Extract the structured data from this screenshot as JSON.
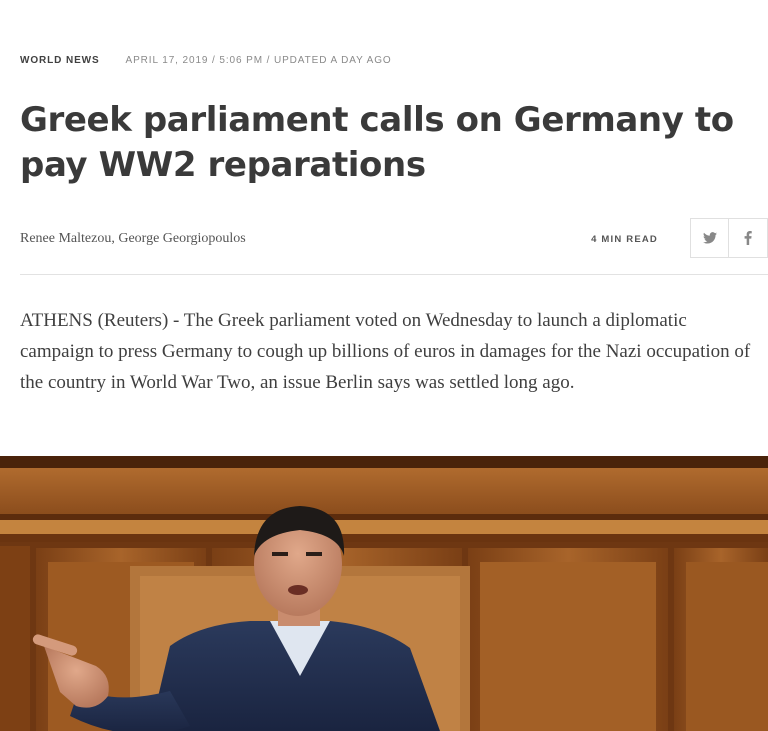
{
  "article": {
    "channel": "World News",
    "timestamp": "April 17, 2019 / 5:06 PM / Updated a day ago",
    "headline": "Greek parliament calls on Germany to pay WW2 reparations",
    "authors": "Renee Maltezou, George Georgiopoulos",
    "read_time": "4 Min Read",
    "lede": "ATHENS (Reuters) - The Greek parliament voted on Wednesday to launch a diplomatic campaign to press Germany to cough up billions of euros in damages for the Nazi occupation of the country in World War Two, an issue Berlin says was settled long ago."
  },
  "share": {
    "twitter_icon": "twitter-icon",
    "facebook_icon": "facebook-icon"
  },
  "colors": {
    "headline": "#3a3a3a",
    "meta": "#8a8a8a",
    "icon": "#888888",
    "wood": "#9a5a24"
  }
}
